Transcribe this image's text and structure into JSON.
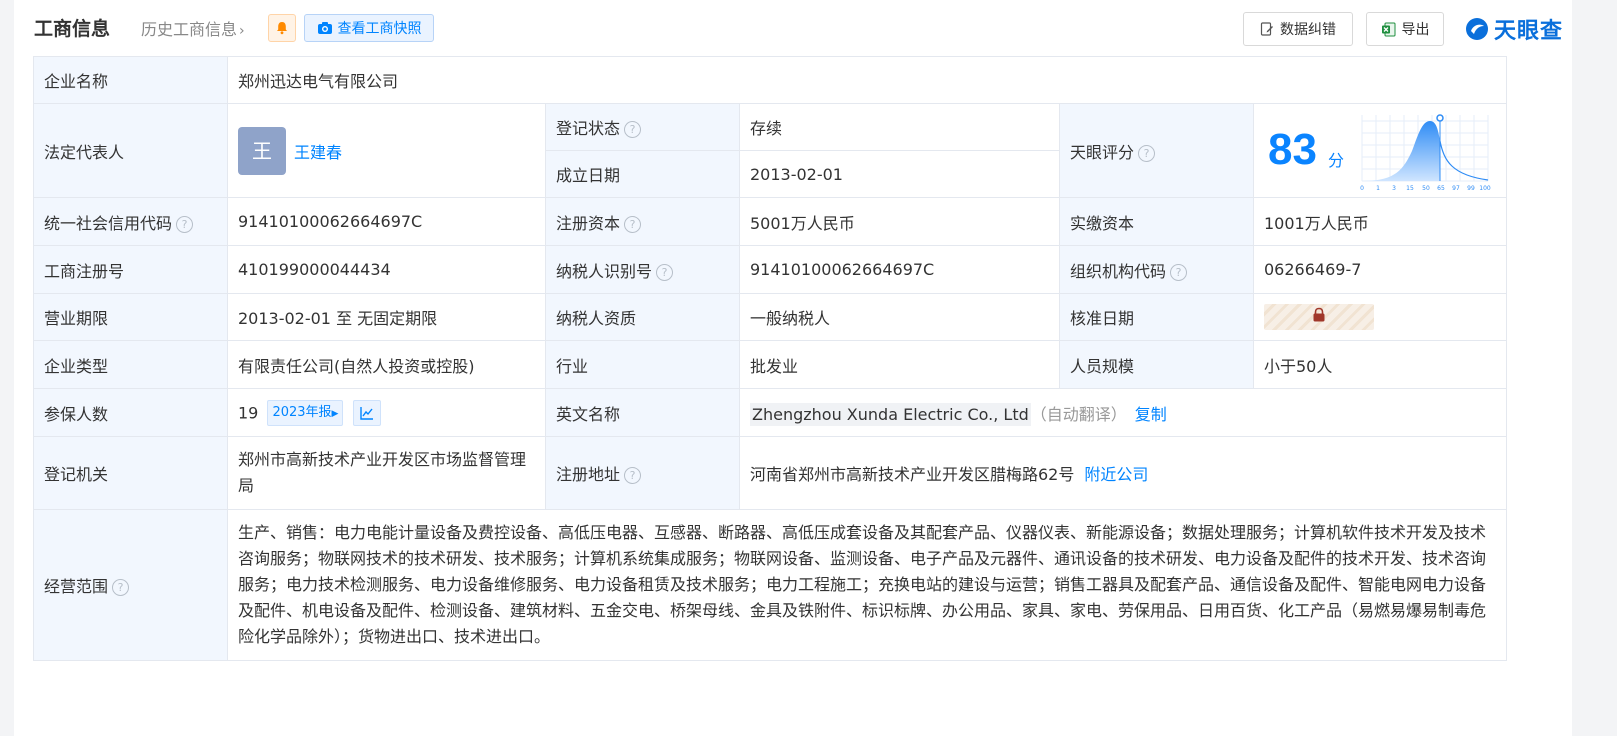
{
  "header": {
    "title": "工商信息",
    "history_link": "历史工商信息",
    "snapshot_button": "查看工商快照",
    "correct_button": "数据纠错",
    "export_button": "导出",
    "logo_text": "天眼查"
  },
  "company": {
    "name_label": "企业名称",
    "name": "郑州迅达电气有限公司",
    "legal_rep_label": "法定代表人",
    "legal_rep_avatar": "王",
    "legal_rep": "王建春",
    "status_label": "登记状态",
    "status": "存续",
    "founded_label": "成立日期",
    "founded": "2013-02-01",
    "score_label": "天眼评分",
    "score": "83",
    "score_unit": "分",
    "score_axis": [
      "0",
      "1",
      "3",
      "15",
      "50",
      "65",
      "97",
      "99",
      "100"
    ],
    "credit_code_label": "统一社会信用代码",
    "credit_code": "91410100062664697C",
    "reg_capital_label": "注册资本",
    "reg_capital": "5001万人民币",
    "paid_capital_label": "实缴资本",
    "paid_capital": "1001万人民币",
    "reg_no_label": "工商注册号",
    "reg_no": "410199000044434",
    "taxpayer_id_label": "纳税人识别号",
    "taxpayer_id": "91410100062664697C",
    "org_code_label": "组织机构代码",
    "org_code": "06266469-7",
    "term_label": "营业期限",
    "term": "2013-02-01 至 无固定期限",
    "taxpayer_qual_label": "纳税人资质",
    "taxpayer_qual": "一般纳税人",
    "approval_date_label": "核准日期",
    "type_label": "企业类型",
    "type": "有限责任公司(自然人投资或控股)",
    "industry_label": "行业",
    "industry": "批发业",
    "staff_label": "人员规模",
    "staff": "小于50人",
    "insured_label": "参保人数",
    "insured": "19",
    "insured_report": "2023年报",
    "english_name_label": "英文名称",
    "english_name": "Zhengzhou Xunda Electric Co., Ltd",
    "auto_translate": "（自动翻译）",
    "copy": "复制",
    "authority_label": "登记机关",
    "authority": "郑州市高新技术产业开发区市场监督管理局",
    "address_label": "注册地址",
    "address": "河南省郑州市高新技术产业开发区腊梅路62号",
    "nearby": "附近公司",
    "scope_label": "经营范围",
    "scope": "生产、销售：电力电能计量设备及费控设备、高低压电器、互感器、断路器、高低压成套设备及其配套产品、仪器仪表、新能源设备；数据处理服务；计算机软件技术开发及技术咨询服务；物联网技术的技术研发、技术服务；计算机系统集成服务；物联网设备、监测设备、电子产品及元器件、通讯设备的技术研发、电力设备及配件的技术开发、技术咨询服务；电力技术检测服务、电力设备维修服务、电力设备租赁及技术服务；电力工程施工；充换电站的建设与运营；销售工器具及配套产品、通信设备及配件、智能电网电力设备及配件、机电设备及配件、检测设备、建筑材料、五金交电、桥架母线、金具及铁附件、标识标牌、办公用品、家具、家电、劳保用品、日用百货、化工产品（易燃易爆易制毒危险化学品除外）；货物进出口、技术进出口。"
  },
  "colors": {
    "accent": "#0084ff",
    "label_bg": "#f2f7fe",
    "status_green": "#26a65b"
  }
}
